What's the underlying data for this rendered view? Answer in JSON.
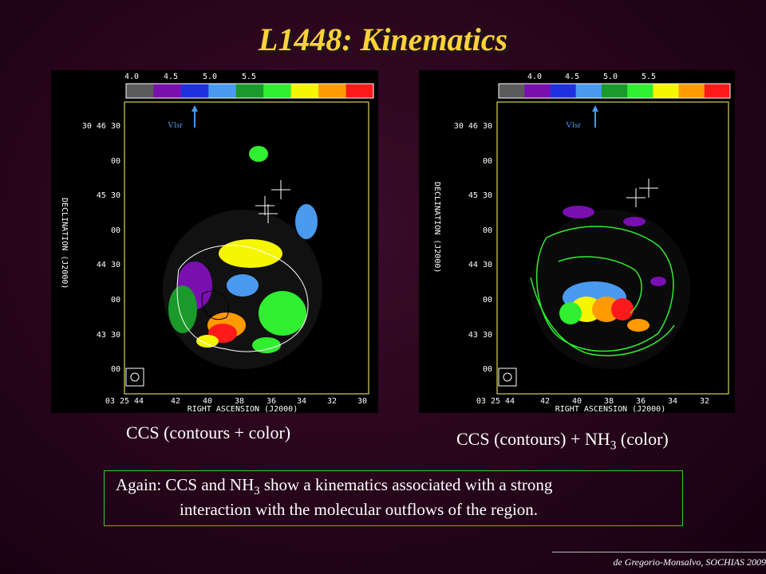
{
  "slide": {
    "title": "L1448: Kinematics",
    "credit": "de Gregorio-Monsalvo, SOCHIAS 2009"
  },
  "panels": {
    "left": {
      "colorbar_ticks": [
        "4.0",
        "4.5",
        "5.0",
        "5.5"
      ],
      "vlsr_label": "Vlsr",
      "y_ticks": [
        "30 46 30",
        "00",
        "45 30",
        "00",
        "44 30",
        "00",
        "43 30",
        "00"
      ],
      "x_ticks": [
        "03 25 44",
        "42",
        "40",
        "38",
        "36",
        "34",
        "32",
        "30"
      ],
      "y_axis_label": "DECLINATION (J2000)",
      "x_axis_label": "RIGHT ASCENSION (J2000)",
      "caption": "CCS (contours + color)"
    },
    "right": {
      "colorbar_ticks": [
        "4.0",
        "4.5",
        "5.0",
        "5.5"
      ],
      "vlsr_label": "Vlsr",
      "y_ticks": [
        "30 46 30",
        "00",
        "45 30",
        "00",
        "44 30",
        "00",
        "43 30",
        "00"
      ],
      "x_ticks": [
        "03 25 44",
        "42",
        "40",
        "38",
        "36",
        "34",
        "32"
      ],
      "y_axis_label": "DECLINATION (J2000)",
      "x_axis_label": "RIGHT ASCENSION (J2000)",
      "caption_prefix": "CCS (contours) + NH",
      "caption_sub": "3",
      "caption_suffix": " (color)"
    }
  },
  "colorbar_colors": [
    "#5a5a5a",
    "#7a0fb0",
    "#2030e0",
    "#4a9af0",
    "#1a9a2a",
    "#30ee30",
    "#f6f600",
    "#ff9a00",
    "#ff1a1a"
  ],
  "note": {
    "line1_a": "Again: CCS and NH",
    "line1_sub": "3",
    "line1_b": " show a kinematics associated with a strong",
    "line2": "interaction with the molecular outflows of the region."
  }
}
